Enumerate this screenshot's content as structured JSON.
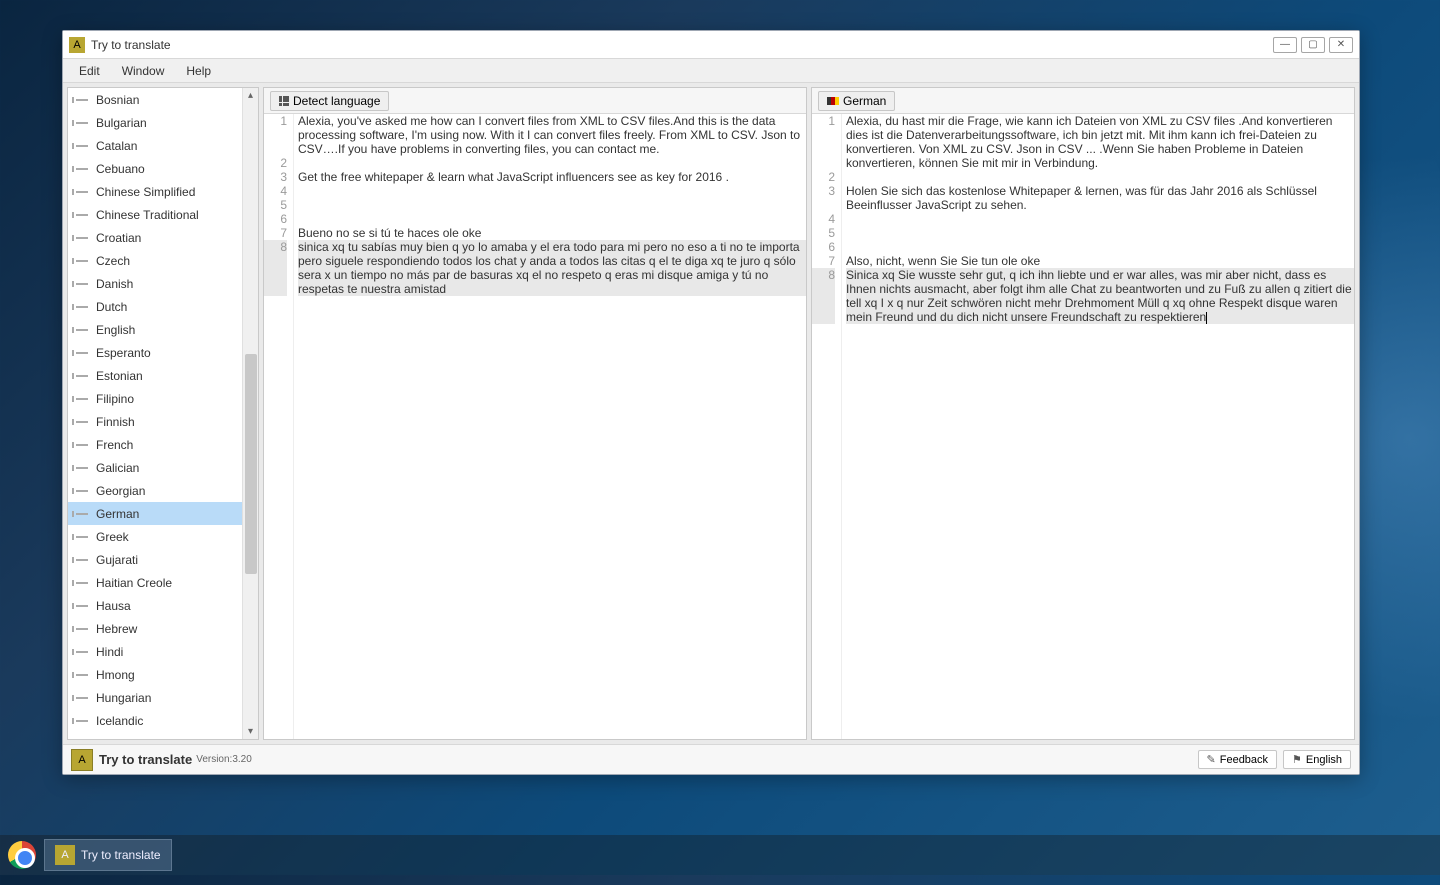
{
  "window": {
    "title": "Try to translate"
  },
  "menubar": [
    "Edit",
    "Window",
    "Help"
  ],
  "languages": [
    "Bosnian",
    "Bulgarian",
    "Catalan",
    "Cebuano",
    "Chinese Simplified",
    "Chinese Traditional",
    "Croatian",
    "Czech",
    "Danish",
    "Dutch",
    "English",
    "Esperanto",
    "Estonian",
    "Filipino",
    "Finnish",
    "French",
    "Galician",
    "Georgian",
    "German",
    "Greek",
    "Gujarati",
    "Haitian Creole",
    "Hausa",
    "Hebrew",
    "Hindi",
    "Hmong",
    "Hungarian",
    "Icelandic"
  ],
  "selected_language": "German",
  "left_pane": {
    "tag": "Detect language",
    "lines": [
      {
        "n": 1,
        "t": "Alexia, you've asked me how can I convert files from XML to CSV files.And this is the data processing software, I'm using now. With it I can convert files freely. From XML to CSV. Json to CSV….If you have problems in converting files, you can contact me."
      },
      {
        "n": 2,
        "t": ""
      },
      {
        "n": 3,
        "t": "Get the free whitepaper & learn what JavaScript influencers see as key for 2016 ."
      },
      {
        "n": 4,
        "t": ""
      },
      {
        "n": 5,
        "t": ""
      },
      {
        "n": 6,
        "t": ""
      },
      {
        "n": 7,
        "t": "Bueno no se si tú te haces ole oke"
      },
      {
        "n": 8,
        "t": "sinica xq tu sabías muy bien q yo lo amaba y el era todo para mi pero no eso a ti no te importa pero siguele respondiendo todos los chat y anda a todos las citas q el te diga xq te juro q sólo sera x un tiempo no más par de basuras xq el no respeto q eras mi disque amiga y tú no respetas te nuestra amistad",
        "sel": true
      }
    ]
  },
  "right_pane": {
    "tag": "German",
    "lines": [
      {
        "n": 1,
        "t": "Alexia, du hast mir die Frage, wie kann ich Dateien von XML zu CSV files .And konvertieren dies ist die Datenverarbeitungssoftware, ich bin jetzt mit. Mit ihm kann ich frei-Dateien zu konvertieren. Von XML zu CSV. Json in CSV ... .Wenn Sie haben Probleme in Dateien konvertieren, können Sie mit mir in Verbindung."
      },
      {
        "n": 2,
        "t": ""
      },
      {
        "n": 3,
        "t": "Holen Sie sich das kostenlose Whitepaper & lernen, was für das Jahr 2016 als Schlüssel Beeinflusser JavaScript zu sehen."
      },
      {
        "n": 4,
        "t": ""
      },
      {
        "n": 5,
        "t": ""
      },
      {
        "n": 6,
        "t": ""
      },
      {
        "n": 7,
        "t": "Also, nicht, wenn Sie Sie tun ole oke"
      },
      {
        "n": 8,
        "t": "Sinica xq Sie wusste sehr gut, q ich ihn liebte und er war alles, was mir aber nicht, dass es Ihnen nichts ausmacht, aber folgt ihm alle Chat zu beantworten und zu Fuß zu allen q zitiert die tell xq I x q nur Zeit schwören nicht mehr Drehmoment Müll q xq ohne Respekt disque waren mein Freund und du dich nicht unsere Freundschaft zu respektieren",
        "sel": true,
        "caret": true
      }
    ]
  },
  "status": {
    "title": "Try to translate",
    "version": "Version:3.20",
    "feedback": "Feedback",
    "lang": "English"
  },
  "taskbar": {
    "app": "Try to translate"
  }
}
